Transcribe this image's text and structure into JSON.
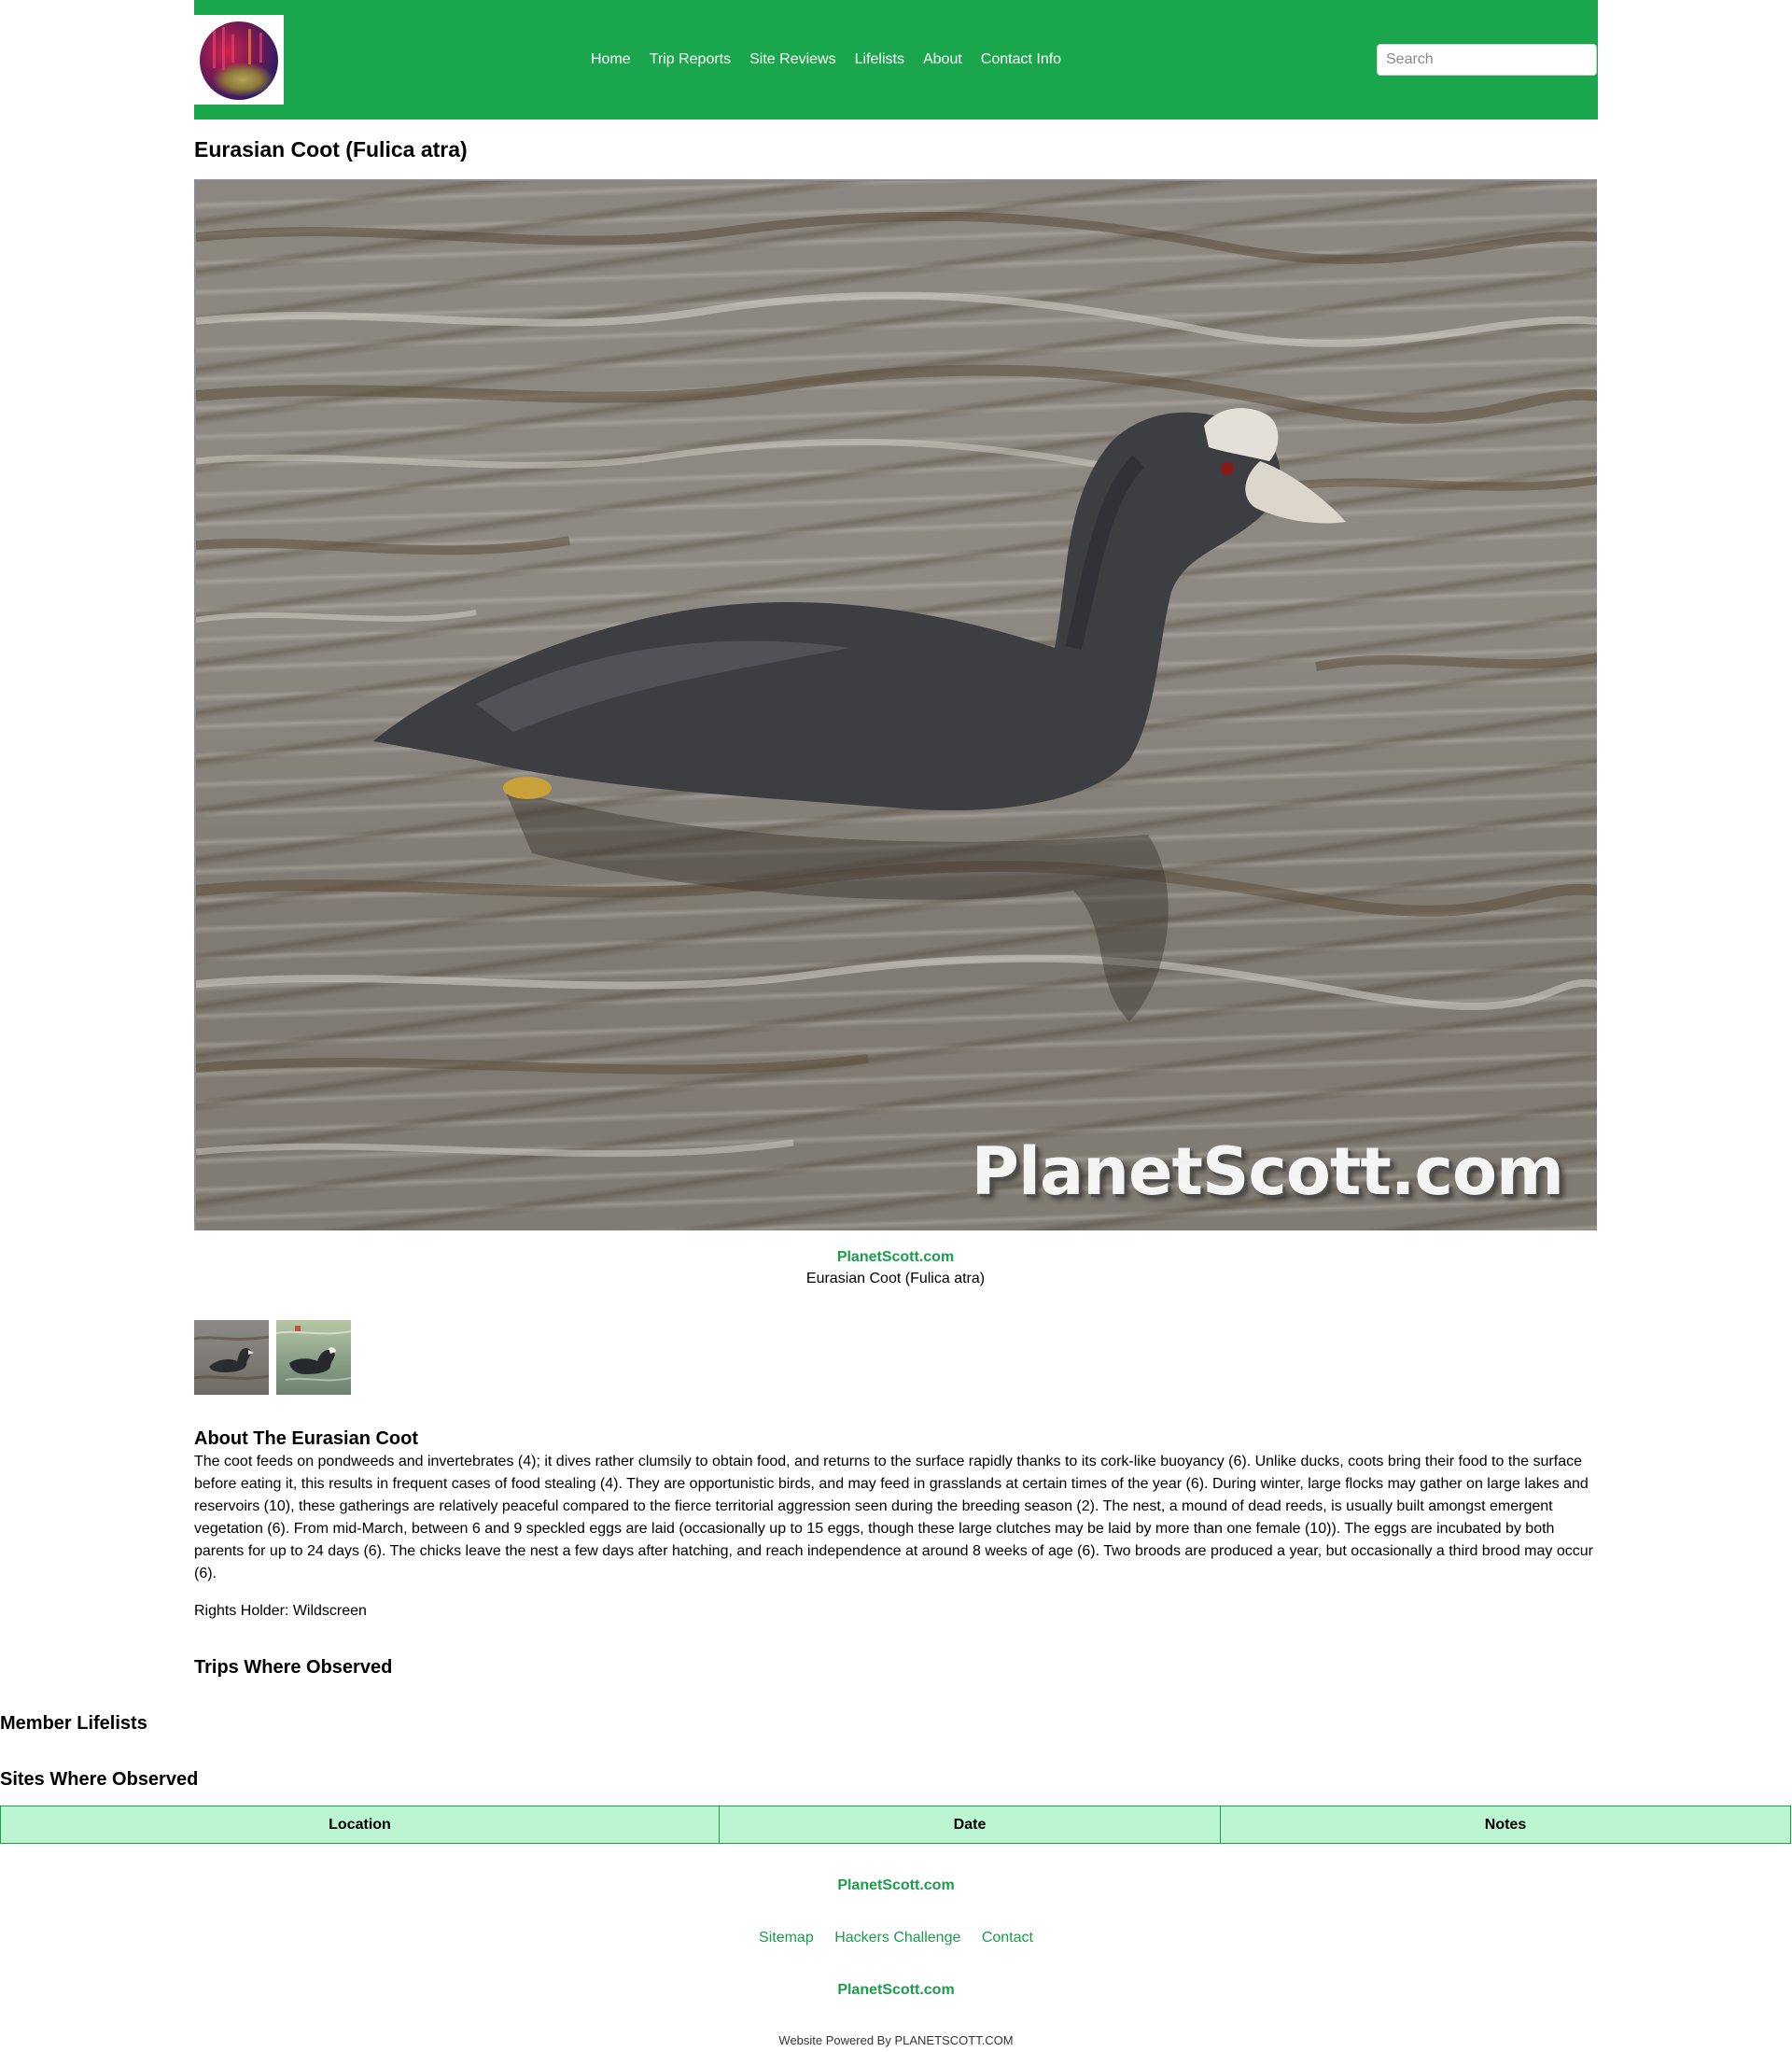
{
  "header": {
    "logo_icon": "planetscott-logo",
    "nav": [
      {
        "label": "Home"
      },
      {
        "label": "Trip Reports"
      },
      {
        "label": "Site Reviews"
      },
      {
        "label": "Lifelists"
      },
      {
        "label": "About"
      },
      {
        "label": "Contact Info"
      }
    ],
    "search": {
      "placeholder": "Search",
      "value": ""
    },
    "background_color": "#1aa64c"
  },
  "page": {
    "title": "Eurasian Coot (Fulica atra)"
  },
  "photo": {
    "watermark": "PlanetScott.com",
    "caption_site": "PlanetScott.com",
    "caption_text": "Eurasian Coot (Fulica atra)",
    "thumbnails": [
      {
        "icon": "coot-thumbnail-1"
      },
      {
        "icon": "coot-thumbnail-2"
      }
    ]
  },
  "about": {
    "title": "About The Eurasian Coot",
    "body": "The coot feeds on pondweeds and invertebrates (4); it dives rather clumsily to obtain food, and returns to the surface rapidly thanks to its cork-like buoyancy (6). Unlike ducks, coots bring their food to the surface before eating it, this results in frequent cases of food stealing (4). They are opportunistic birds, and may feed in grasslands at certain times of the year (6). During winter, large flocks may gather on large lakes and reservoirs (10), these gatherings are relatively peaceful compared to the fierce territorial aggression seen during the breeding season (2). The nest, a mound of dead reeds, is usually built amongst emergent vegetation (6). From mid-March, between 6 and 9 speckled eggs are laid (occasionally up to 15 eggs, though these large clutches may be laid by more than one female (10)). The eggs are incubated by both parents for up to 24 days (6). The chicks leave the nest a few days after hatching, and reach independence at around 8 weeks of age (6). Two broods are produced a year, but occasionally a third brood may occur (6).",
    "rights_holder": "Rights Holder: Wildscreen"
  },
  "sections": {
    "trips_title": "Trips Where Observed",
    "lifelists_title": "Member Lifelists",
    "sites_title": "Sites Where Observed"
  },
  "sites_table": {
    "columns": [
      "Location",
      "Date",
      "Notes"
    ],
    "rows": [],
    "header_color": "#bcf5d2",
    "border_color": "#1a9e4a"
  },
  "footer": {
    "site_name_1": "PlanetScott.com",
    "links": [
      {
        "label": "Sitemap"
      },
      {
        "label": "Hackers Challenge"
      },
      {
        "label": "Contact"
      }
    ],
    "site_name_2": "PlanetScott.com",
    "powered_by": "Website Powered By PLANETSCOTT.COM",
    "link_color": "#1a9e4a"
  }
}
